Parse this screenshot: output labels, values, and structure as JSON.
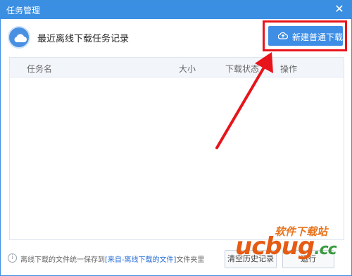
{
  "window": {
    "title": "任务管理"
  },
  "header": {
    "heading": "最近离线下载任务记录"
  },
  "toolbar": {
    "new_download_label": "新建普通下载"
  },
  "table": {
    "columns": [
      "任务名",
      "大小",
      "下载状态",
      "操作"
    ],
    "rows": []
  },
  "footer": {
    "note_prefix": "离线下载的文件统一保存到",
    "note_link": "[来自-离线下载的文件]",
    "note_suffix": "文件夹里",
    "clear_history_label": "清空历史记录",
    "run_label": "运行"
  },
  "watermark": {
    "cn_text": "软件下载站",
    "brand": "ucbug",
    "suffix": ".cc"
  },
  "colors": {
    "titlebar": "#3b8fe2",
    "button": "#3f8ee6",
    "highlight": "#e8141b"
  }
}
